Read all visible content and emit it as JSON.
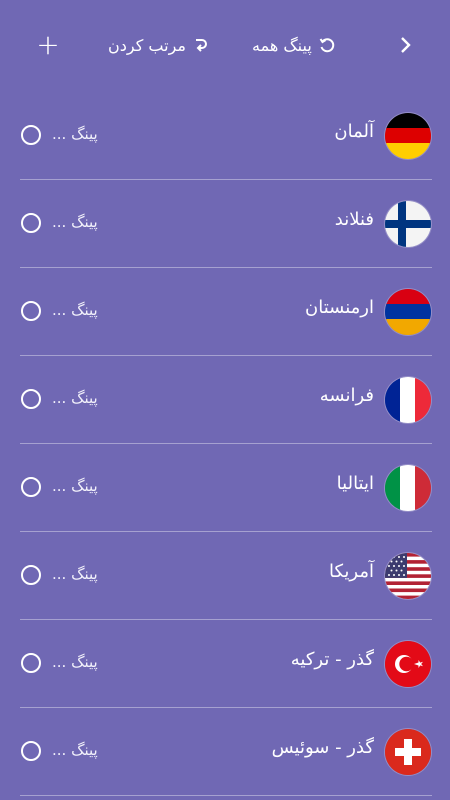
{
  "toolbar": {
    "add_label": "+",
    "sort_label": "مرتب کردن",
    "ping_all_label": "پینگ همه",
    "back_icon": "chevron-right-icon"
  },
  "servers": [
    {
      "name": "آلمان",
      "ping": "پینگ ...",
      "flag": "germany"
    },
    {
      "name": "فنلاند",
      "ping": "پینگ ...",
      "flag": "finland"
    },
    {
      "name": "ارمنستان",
      "ping": "پینگ ...",
      "flag": "armenia"
    },
    {
      "name": "فرانسه",
      "ping": "پینگ ...",
      "flag": "france"
    },
    {
      "name": "ایتالیا",
      "ping": "پینگ ...",
      "flag": "italy"
    },
    {
      "name": "آمریکا",
      "ping": "پینگ ...",
      "flag": "usa"
    },
    {
      "name": "گذر - ترکیه",
      "ping": "پینگ ...",
      "flag": "turkey"
    },
    {
      "name": "گذر - سوئیس",
      "ping": "پینگ ...",
      "flag": "switzerland"
    }
  ],
  "colors": {
    "background": "#7068b4",
    "text": "#ffffff"
  }
}
